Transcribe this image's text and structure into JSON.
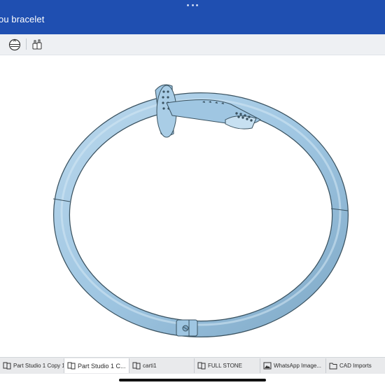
{
  "window": {
    "title": "ou bracelet"
  },
  "toolbar": {
    "buttons": [
      {
        "icon": "view-cube-icon"
      },
      {
        "icon": "appearance-icon"
      }
    ]
  },
  "tabs": [
    {
      "label": "Part Studio 1 Copy 1",
      "icon": "part-studio-icon",
      "active": false
    },
    {
      "label": "Part Studio 1 C...",
      "icon": "part-studio-icon",
      "active": true
    },
    {
      "label": "carti1",
      "icon": "part-studio-icon",
      "active": false
    },
    {
      "label": "FULL STONE",
      "icon": "part-studio-icon",
      "active": false
    },
    {
      "label": "WhatsApp Image...",
      "icon": "image-icon",
      "active": false
    },
    {
      "label": "CAD Imports",
      "icon": "folder-icon",
      "active": false
    }
  ],
  "colors": {
    "title_bar": "#1f4fb1",
    "toolbar": "#eef0f3",
    "model": "#9fc6e2",
    "model_edge": "#3a5260"
  }
}
